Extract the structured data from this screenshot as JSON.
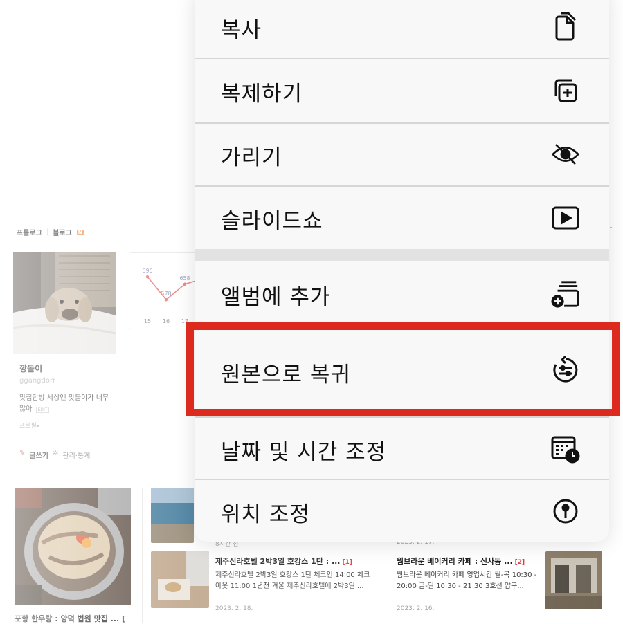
{
  "blog": {
    "tabs": [
      "프롤로그",
      "블로그"
    ],
    "tab_badge": "N",
    "profile": {
      "name": "깡돌이",
      "id": "ggangdorr",
      "description": "맛집탐방 세상엔 맛돌이가 너무 많아",
      "edit_label": "EDIT",
      "profile_link": "프로필▸"
    },
    "actions": {
      "write": "글쓰기",
      "manage": "관리·통계"
    },
    "stats": {
      "values": [
        696,
        578,
        658
      ],
      "days": [
        "15",
        "16",
        "17"
      ]
    },
    "posts": [
      {
        "meta": "8시간 전",
        "title": "제주신라호텔 2박3일 호캉스 1탄 : ...",
        "comments": "[1]",
        "body": "제주신라호텔 2박3일 호캉스 1탄 체크인 14:00 체크아웃 11:00 1년전 겨울 제주신라호텔에 2박3일 ...",
        "date": "2023. 2. 18."
      },
      {
        "meta": "2023. 2. 17.",
        "title": "웜브라운 베이커리 카페 : 신사동 ...",
        "comments": "[2]",
        "body": "웜브라운 베이커리 카페 영업시간 월-목 10:30 - 20:00 금-일 10:30 - 21:30 3호선 압구...",
        "date": "2023. 2. 16."
      }
    ],
    "bottom_post_title": "포항 한우랑 : 양덕 법원 맛집 ... ["
  },
  "menu": {
    "group1": [
      {
        "label": "복사",
        "icon": "copy-icon"
      },
      {
        "label": "복제하기",
        "icon": "duplicate-icon"
      },
      {
        "label": "가리기",
        "icon": "eye-slash-icon"
      },
      {
        "label": "슬라이드쇼",
        "icon": "play-icon"
      }
    ],
    "group2": [
      {
        "label": "앨범에 추가",
        "icon": "add-to-album-icon"
      },
      {
        "label": "원본으로 복귀",
        "icon": "revert-icon"
      },
      {
        "label": "날짜 및 시간 조정",
        "icon": "calendar-clock-icon"
      },
      {
        "label": "위치 조정",
        "icon": "location-pin-icon"
      }
    ],
    "highlighted_item": "원본으로 복귀",
    "highlight_color": "#dd2a1f"
  }
}
